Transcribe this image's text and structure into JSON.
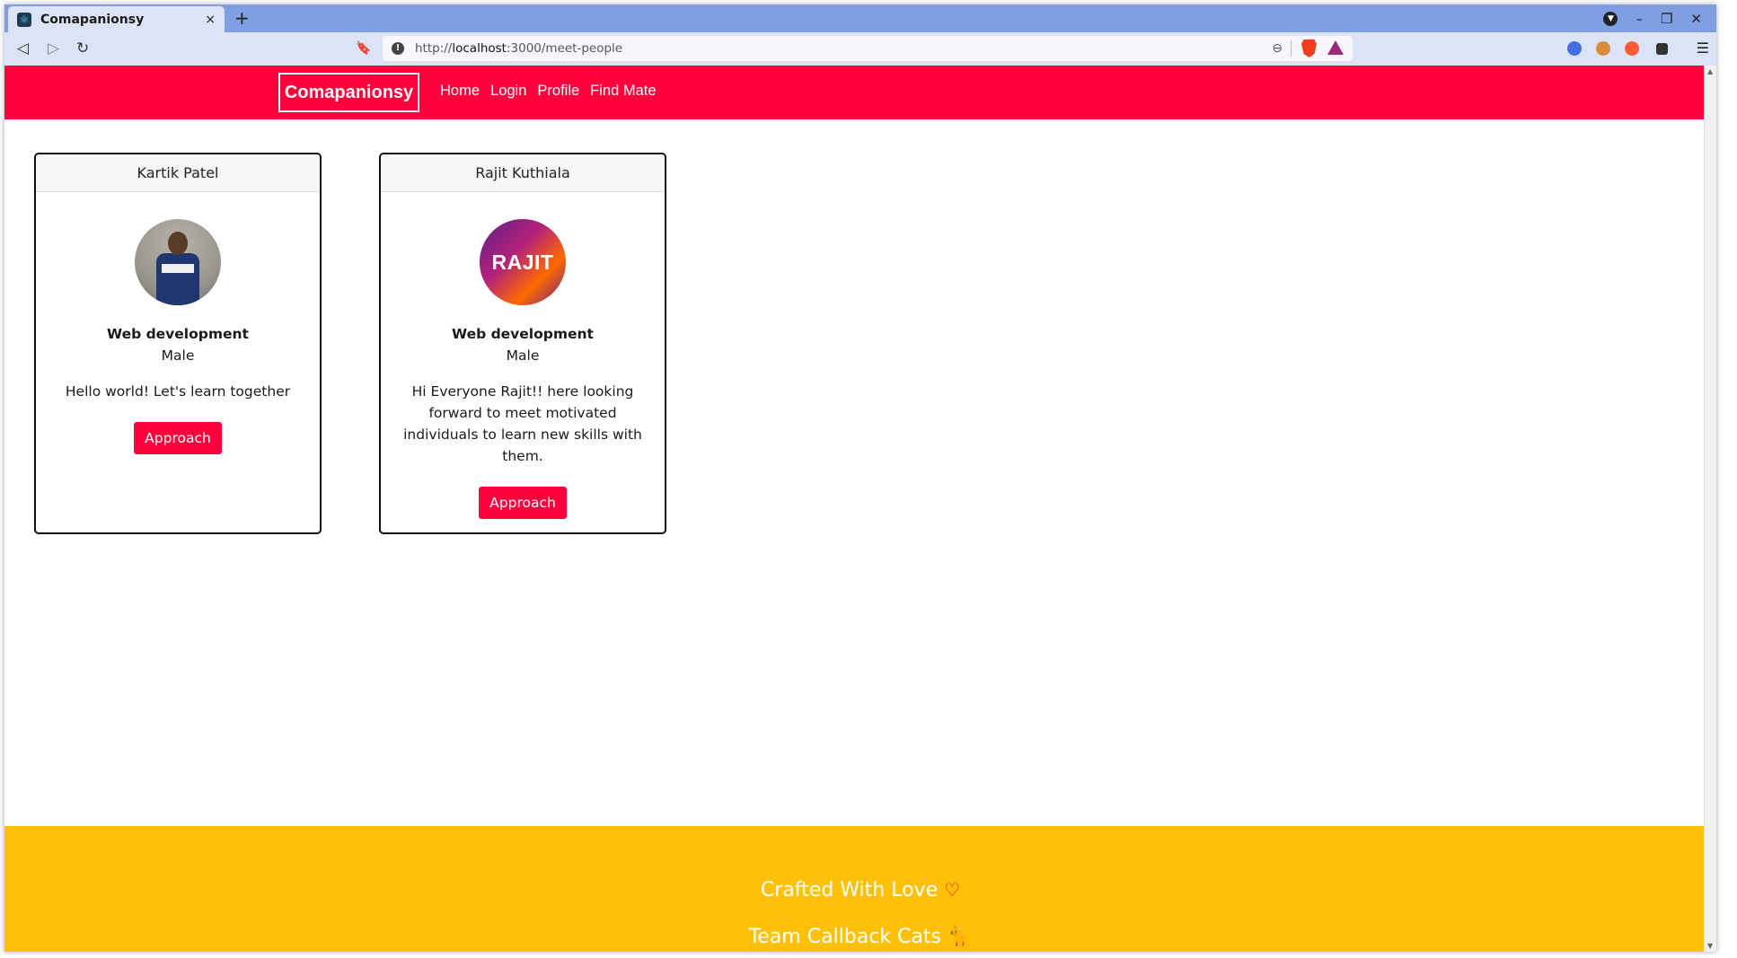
{
  "browser": {
    "tab_title": "Comapanionsy",
    "tab_close": "×",
    "new_tab": "+",
    "url_prefix": "http://",
    "url_host": "localhost",
    "url_path": ":3000/meet-people",
    "menu": "☰"
  },
  "navbar": {
    "brand": "Comapanionsy",
    "links": [
      "Home",
      "Login",
      "Profile",
      "Find Mate"
    ]
  },
  "people": [
    {
      "name": "Kartik Patel",
      "interest": "Web development",
      "gender": "Male",
      "bio": "Hello world! Let's learn together",
      "button": "Approach"
    },
    {
      "name": "Rajit Kuthiala",
      "avatar_text": "RAJIT",
      "interest": "Web development",
      "gender": "Male",
      "bio": "Hi Everyone Rajit!! here looking forward to meet motivated individuals to learn new skills with them.",
      "button": "Approach"
    }
  ],
  "footer": {
    "line1": "Crafted With Love",
    "line2": "Team Callback Cats"
  },
  "colors": {
    "primary": "#ff003c",
    "footer": "#ffc107"
  }
}
